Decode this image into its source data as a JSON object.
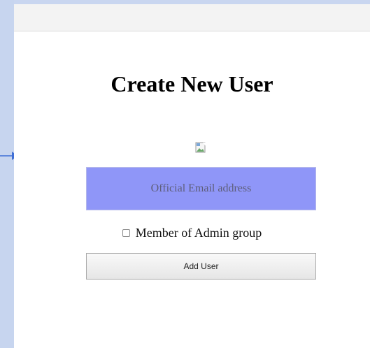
{
  "form": {
    "title": "Create New User",
    "email_placeholder": "Official Email address",
    "admin_checkbox_label": "Member of Admin group",
    "submit_label": "Add User"
  },
  "icons": {
    "arrow": "arrow-right-icon",
    "broken_image": "broken-image-icon"
  },
  "colors": {
    "email_field_bg": "#8f96f8",
    "arrow": "#3f6fd6"
  }
}
